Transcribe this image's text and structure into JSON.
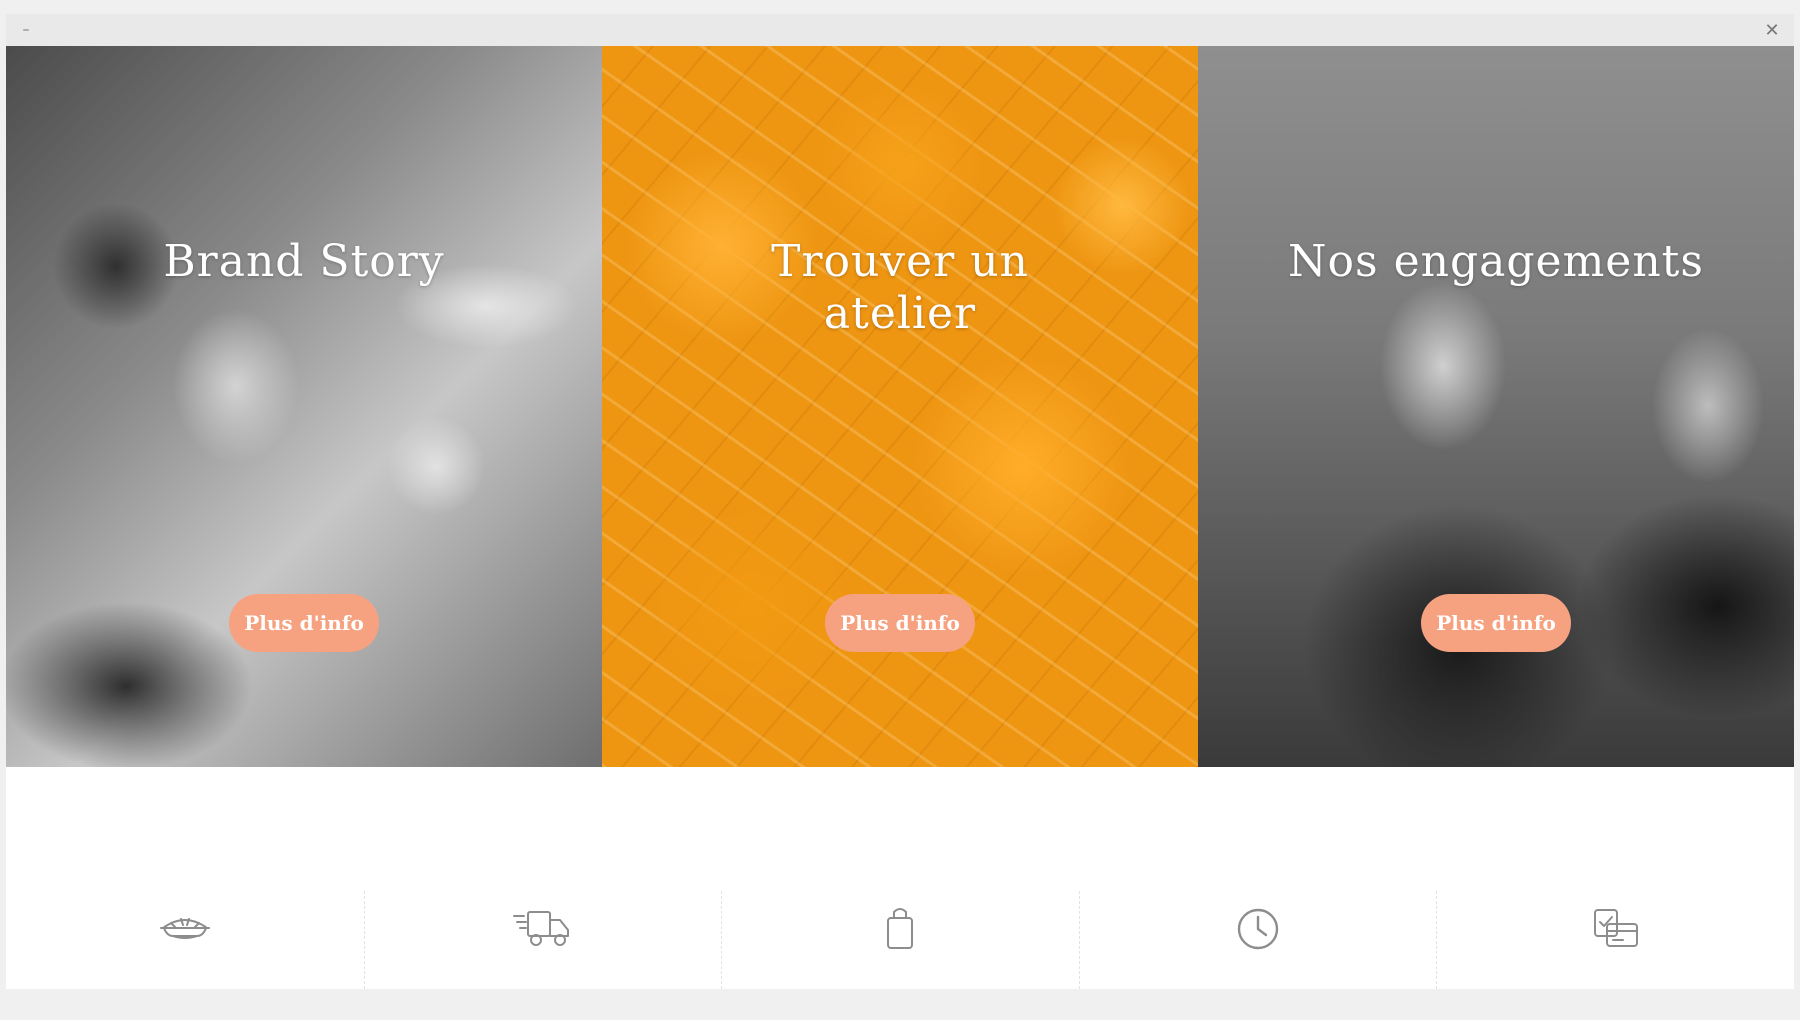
{
  "window": {
    "minimize_glyph": "–",
    "close_glyph": "✕"
  },
  "panels": [
    {
      "title": "Brand Story",
      "button": "Plus d'info",
      "photo": "vintage-tea-party-photo"
    },
    {
      "title": "Trouver un atelier",
      "button": "Plus d'info",
      "photo": "orange-slices-photo"
    },
    {
      "title": "Nos engagements",
      "button": "Plus d'info",
      "photo": "vintage-smiling-friends-photo"
    }
  ],
  "services": [
    {
      "icon": "pie-icon"
    },
    {
      "icon": "delivery-truck-icon"
    },
    {
      "icon": "shopping-bag-icon"
    },
    {
      "icon": "clock-icon"
    },
    {
      "icon": "card-payment-icon"
    }
  ],
  "colors": {
    "button_bg": "#f6a280",
    "icon_stroke": "#8d8d8d",
    "titlebar_bg": "#e9e9e9"
  }
}
